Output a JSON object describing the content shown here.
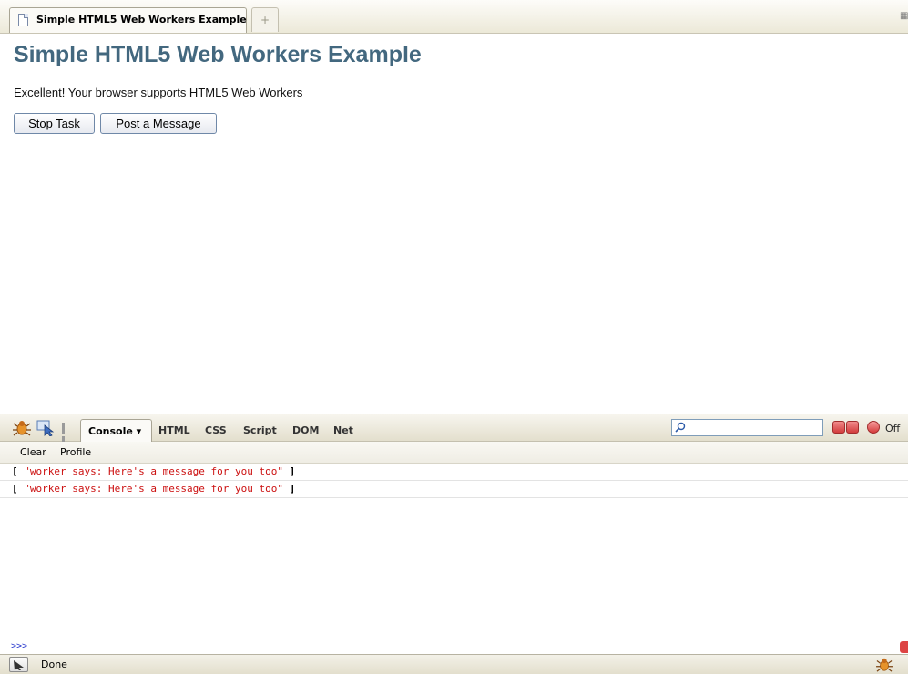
{
  "browser": {
    "tab": {
      "title": "Simple HTML5 Web Workers Example"
    },
    "new_tab_symbol": "+"
  },
  "page": {
    "heading": "Simple HTML5 Web Workers Example",
    "support_message": "Excellent! Your browser supports HTML5 Web Workers",
    "buttons": {
      "stop": "Stop Task",
      "post": "Post a Message"
    }
  },
  "firebug": {
    "tabs": {
      "console": "Console",
      "html": "HTML",
      "css": "CSS",
      "script": "Script",
      "dom": "DOM",
      "net": "Net"
    },
    "dropdown_arrow": "▾",
    "search": {
      "value": ""
    },
    "off_label": "Off",
    "sub": {
      "clear": "Clear",
      "profile": "Profile"
    },
    "log": [
      {
        "open": "[",
        "text": "\"worker says: Here's a message for you too\"",
        "close": "]"
      },
      {
        "open": "[",
        "text": "\"worker says: Here's a message for you too\"",
        "close": "]"
      }
    ],
    "prompt": ">>>"
  },
  "statusbar": {
    "text": "Done"
  },
  "colors": {
    "heading": "#43687f",
    "log_string": "#cc1111",
    "prompt": "#2233cc"
  },
  "icons": [
    "document-icon",
    "tab-close-icon",
    "firebug-icon",
    "inspect-icon",
    "pause-icon",
    "search-icon",
    "minimize-icon",
    "detach-icon",
    "power-icon",
    "inspect-arrow-icon"
  ]
}
